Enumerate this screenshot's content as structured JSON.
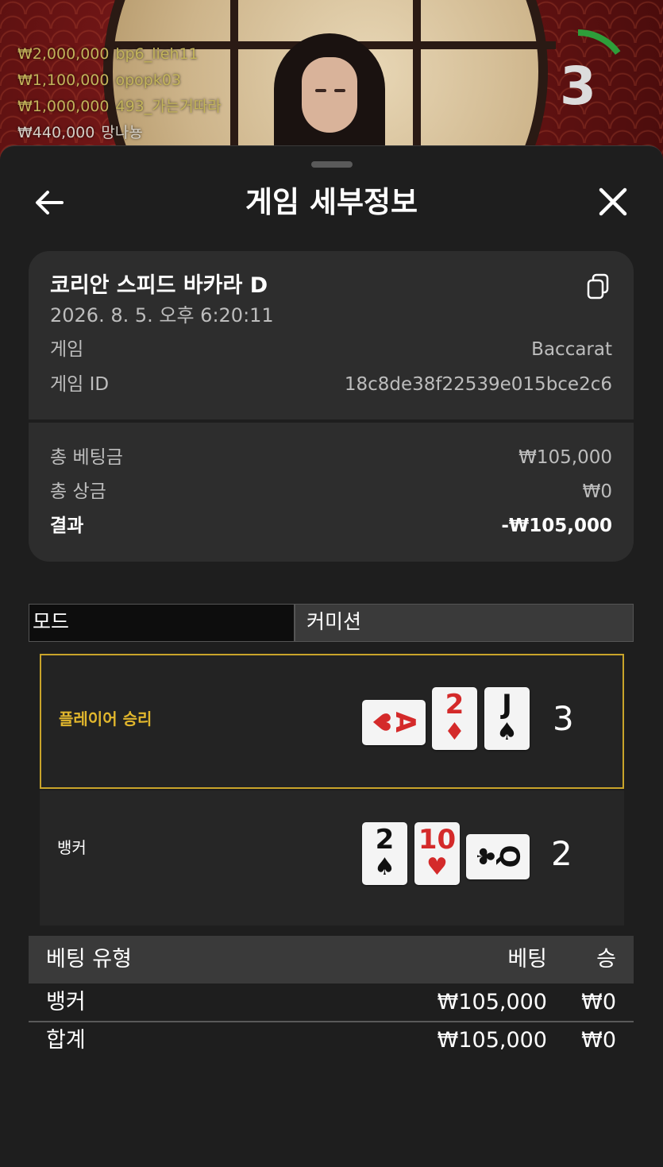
{
  "leaderboard": [
    {
      "amount": "₩2,000,000",
      "user": "bp6_lieh11"
    },
    {
      "amount": "₩1,100,000",
      "user": "opopk03"
    },
    {
      "amount": "₩1,000,000",
      "user": "493_가는거따라"
    },
    {
      "amount": "₩440,000",
      "user": "망나뇽"
    }
  ],
  "timer": {
    "value": "3",
    "progress": 0.15,
    "color": "#2e9e3a"
  },
  "sheet": {
    "title": "게임 세부정보",
    "back_icon": "arrow-left-icon",
    "close_icon": "close-icon"
  },
  "game": {
    "title": "코리안 스피드 바카라 D",
    "date": "2026. 8. 5. 오후 6:20:11",
    "copy_icon": "copy-icon",
    "game_label": "게임",
    "game_value": "Baccarat",
    "id_label": "게임 ID",
    "id_value": "18c8de38f22539e015bce2c6",
    "total_bet_label": "총 베팅금",
    "total_bet_value": "₩105,000",
    "total_win_label": "총 상금",
    "total_win_value": "₩0",
    "result_label": "결과",
    "result_value": "-₩105,000"
  },
  "tabs": {
    "mode": "모드",
    "commission": "커미션"
  },
  "player": {
    "label": "플레이어 승리",
    "score": "3",
    "cards": [
      {
        "rank": "A",
        "suit": "♥",
        "color": "red",
        "orientation": "sideways"
      },
      {
        "rank": "2",
        "suit": "♦",
        "color": "red",
        "orientation": "upright"
      },
      {
        "rank": "J",
        "suit": "♠",
        "color": "black",
        "orientation": "upright"
      }
    ]
  },
  "banker": {
    "label": "뱅커",
    "score": "2",
    "cards": [
      {
        "rank": "2",
        "suit": "♠",
        "color": "black",
        "orientation": "upright"
      },
      {
        "rank": "10",
        "suit": "♥",
        "color": "red",
        "orientation": "upright"
      },
      {
        "rank": "Q",
        "suit": "♣",
        "color": "black",
        "orientation": "sideways"
      }
    ]
  },
  "bets": {
    "headers": {
      "type": "베팅 유형",
      "bet": "베팅",
      "win": "승"
    },
    "rows": [
      {
        "type": "뱅커",
        "bet": "₩105,000",
        "win": "₩0"
      },
      {
        "type": "합계",
        "bet": "₩105,000",
        "win": "₩0"
      }
    ]
  }
}
